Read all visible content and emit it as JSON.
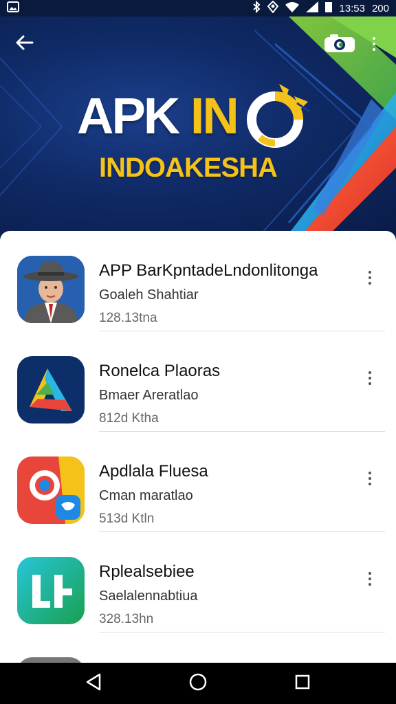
{
  "status_bar": {
    "time": "13:53",
    "battery": "200",
    "icons": [
      "image-icon",
      "bluetooth-icon",
      "location-icon",
      "wifi-icon",
      "signal-icon",
      "battery-icon"
    ]
  },
  "header": {
    "logo_title_white": "APK ",
    "logo_title_yellow": "IN",
    "logo_title_o": "O",
    "logo_subtitle": "INDOAKESHA",
    "icons": [
      "back-arrow-icon",
      "camera-icon",
      "more-vert-icon"
    ]
  },
  "apps": [
    {
      "name": "APP BarKpntadeLndonlitonga",
      "developer": "Goaleh Shahtiar",
      "size": "128.13tna",
      "icon": "person-hat-icon"
    },
    {
      "name": "Ronelca Plaoras",
      "developer": "Bmaer Areratlao",
      "size": "812d Ktha",
      "icon": "triangle-logo-icon"
    },
    {
      "name": "Apdlala Fluesa",
      "developer": "Cman maratlao",
      "size": "513d Ktln",
      "icon": "browser-chat-icon"
    },
    {
      "name": "Rplealsebiee",
      "developer": "Saelalennabtiua",
      "size": "328.13hn",
      "icon": "letter-logo-icon"
    }
  ],
  "nav_bar": {
    "icons": [
      "back-triangle-icon",
      "home-circle-icon",
      "recents-square-icon"
    ]
  },
  "colors": {
    "accent_yellow": "#f4c218",
    "banner_blue": "#0f2a66",
    "card_white": "#ffffff"
  }
}
